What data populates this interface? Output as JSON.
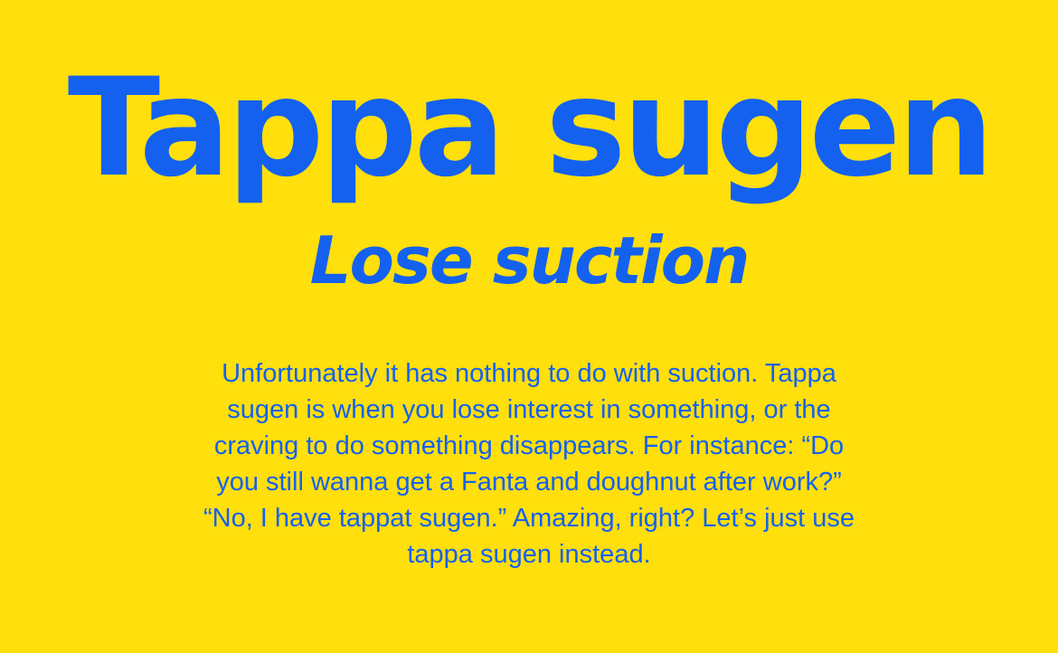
{
  "colors": {
    "background": "#FFDF0C",
    "text": "#1461F0"
  },
  "headline": "Tappa sugen",
  "subtitle": "Lose suction",
  "body_lines": [
    "Unfortunately it has nothing to do with suction. Tappa",
    "sugen is when you lose interest in something, or the",
    "craving to do something disappears. For instance: “Do",
    "you still wanna get a Fanta and doughnut after work?”",
    "“No, I have tappat sugen.” Amazing, right? Let’s just use",
    "tappa sugen instead."
  ]
}
